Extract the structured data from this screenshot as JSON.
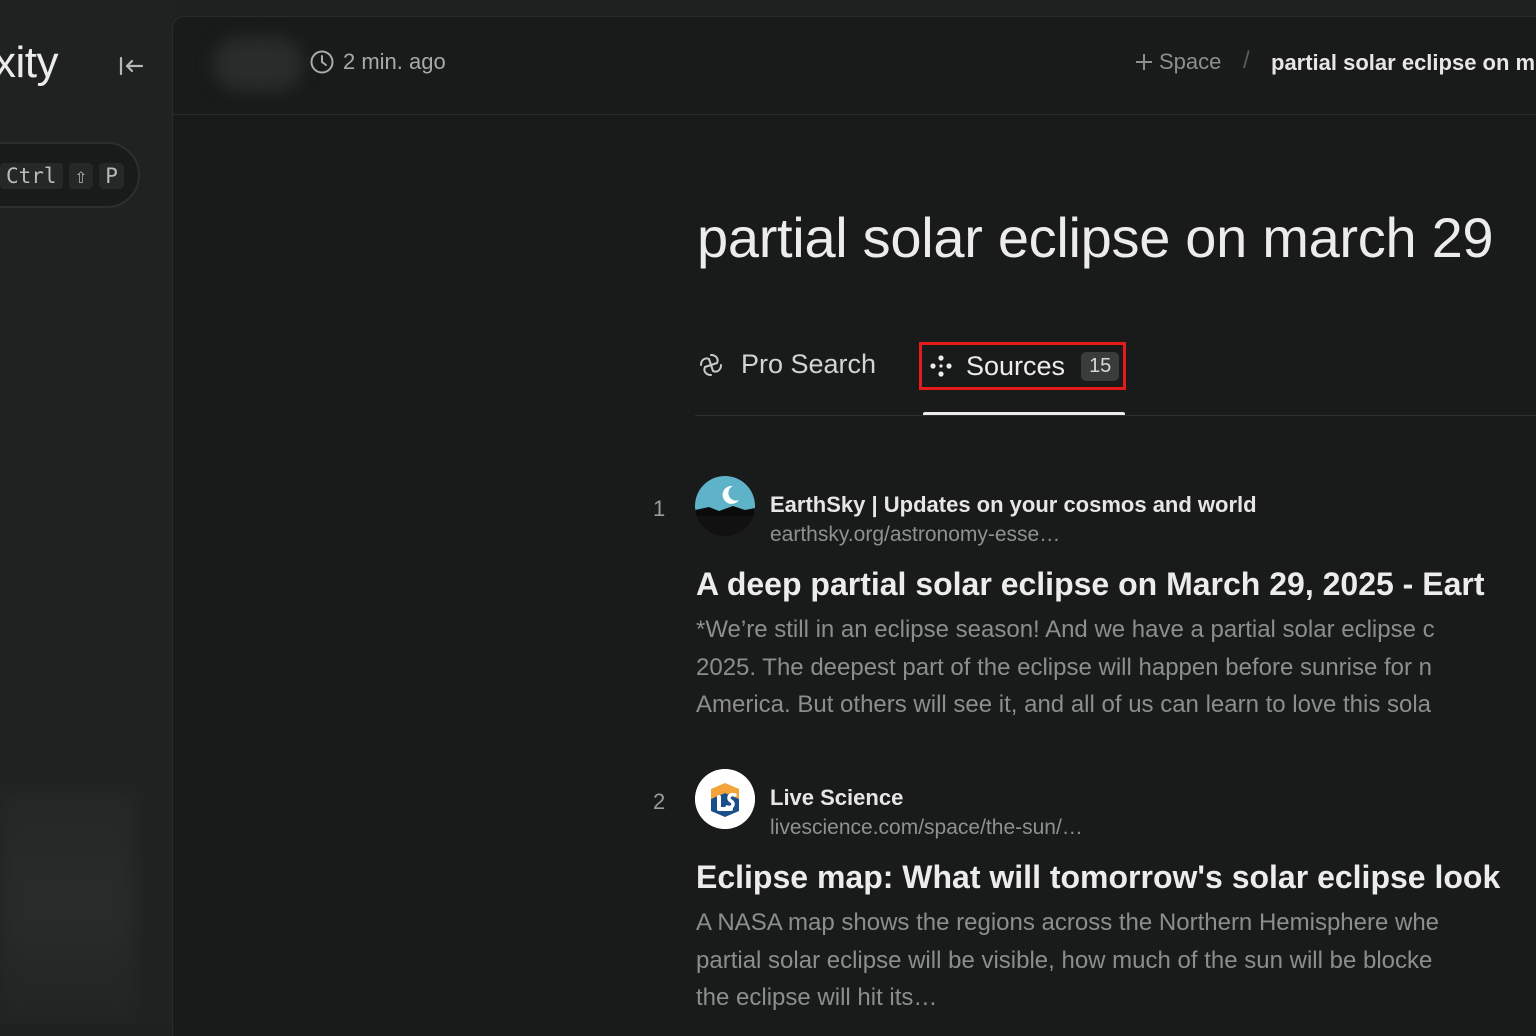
{
  "sidebar": {
    "logo_text": "xity",
    "collapse_icon": "collapse-left-icon",
    "shortcut": {
      "key1": "Ctrl",
      "key2": "⇧",
      "key3": "P"
    }
  },
  "header": {
    "time_ago": "2 min. ago",
    "space_label": "Space",
    "breadcrumb_sep": "/",
    "thread_title": "partial solar eclipse on m"
  },
  "main": {
    "query": "partial solar eclipse on march 29",
    "tabs": [
      {
        "label": "Pro Search",
        "icon": "pro-search-icon"
      },
      {
        "label": "Sources",
        "icon": "sources-icon",
        "count": "15",
        "active": true
      }
    ],
    "results": [
      {
        "index": "1",
        "source": "EarthSky | Updates on your cosmos and world",
        "url": "earthsky.org/astronomy-esse…",
        "title": "A deep partial solar eclipse on March 29, 2025 - Eart",
        "snippet": [
          "*We’re still in an eclipse season! And we have a partial solar eclipse c",
          "2025. The deepest part of the eclipse will happen before sunrise for n",
          "America. But others will see it, and all of us can learn to love this sola"
        ]
      },
      {
        "index": "2",
        "source": "Live Science",
        "url": "livescience.com/space/the-sun/…",
        "title": "Eclipse map: What will tomorrow's solar eclipse look",
        "snippet": [
          "A NASA map shows the regions across the Northern Hemisphere whe",
          "partial solar eclipse will be visible, how much of the sun will be blocke",
          "the eclipse will hit its…"
        ]
      }
    ]
  },
  "colors": {
    "background": "#1f2020",
    "panel": "#191a1a",
    "highlight_box": "#e31b1b"
  }
}
